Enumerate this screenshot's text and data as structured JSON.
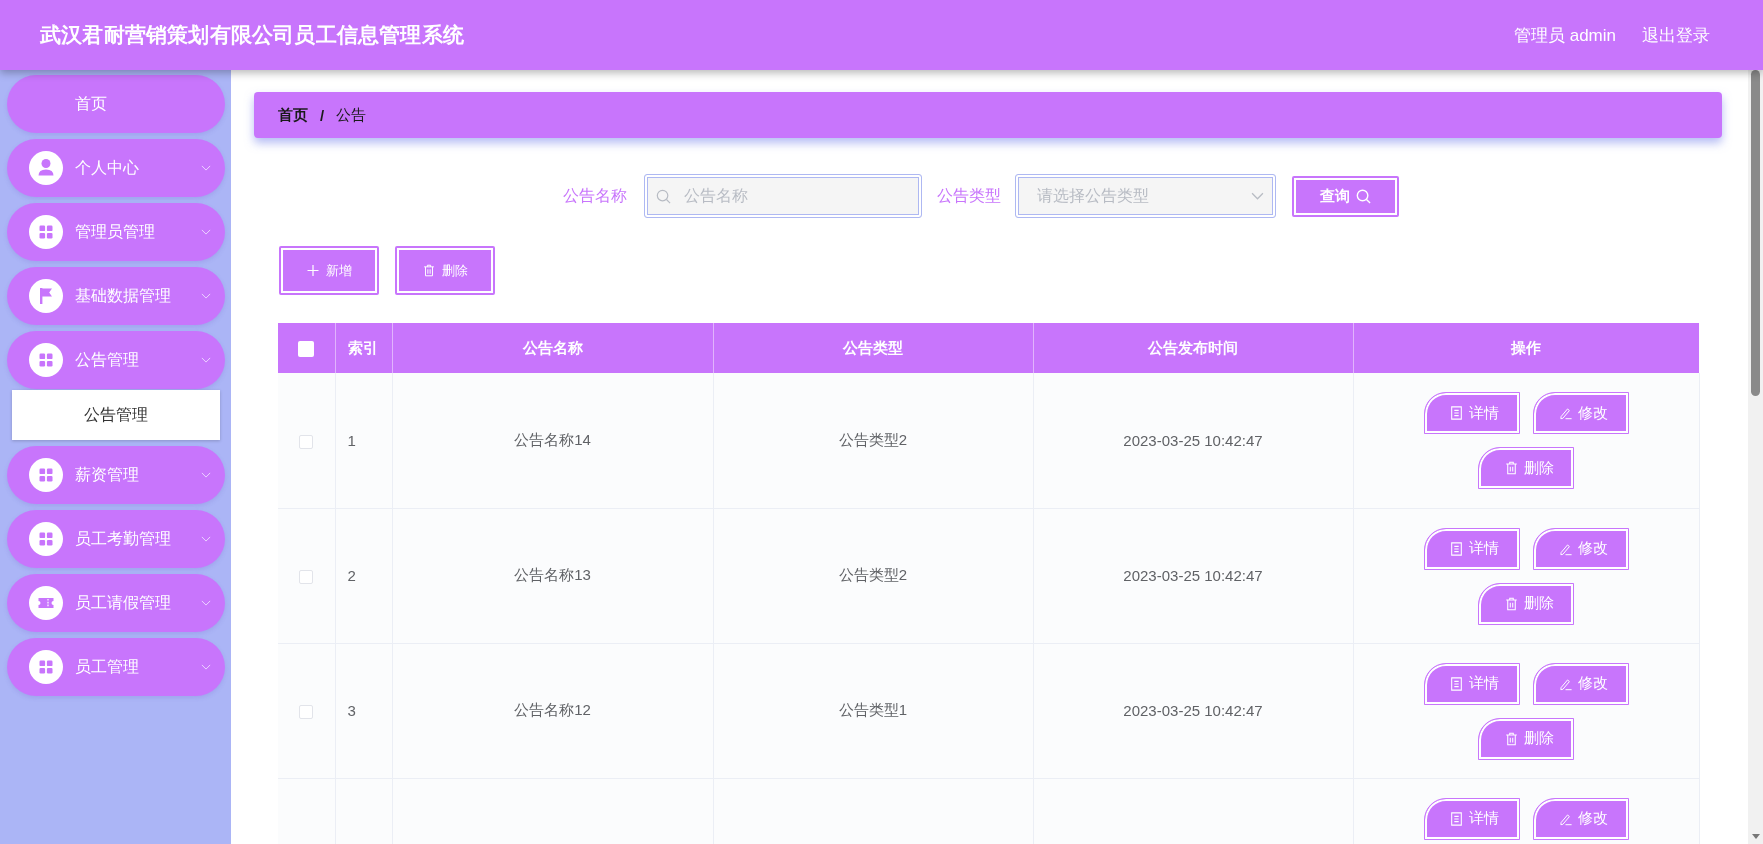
{
  "header": {
    "title": "武汉君耐营销策划有限公司员工信息管理系统",
    "user": "管理员 admin",
    "logout": "退出登录"
  },
  "sidebar": {
    "items": [
      {
        "label": "首页",
        "kind": "link"
      },
      {
        "label": "个人中心",
        "kind": "user"
      },
      {
        "label": "管理员管理",
        "kind": "grid"
      },
      {
        "label": "基础数据管理",
        "kind": "flag"
      },
      {
        "label": "公告管理",
        "kind": "grid",
        "children": [
          {
            "label": "公告管理",
            "selected": true
          }
        ]
      },
      {
        "label": "薪资管理",
        "kind": "grid"
      },
      {
        "label": "员工考勤管理",
        "kind": "grid"
      },
      {
        "label": "员工请假管理",
        "kind": "ticket"
      },
      {
        "label": "员工管理",
        "kind": "grid"
      }
    ]
  },
  "breadcrumb": {
    "separator": "/",
    "items": [
      {
        "label": "首页",
        "kind": "link"
      },
      {
        "label": "公告",
        "kind": "current"
      }
    ]
  },
  "search": {
    "fields": [
      {
        "label": "公告名称",
        "kind": "input",
        "placeholder": "公告名称"
      },
      {
        "label": "公告类型",
        "kind": "select",
        "placeholder": "请选择公告类型"
      }
    ],
    "button": "查询"
  },
  "toolbar": {
    "buttons": [
      {
        "label": "新增",
        "kind": "add"
      },
      {
        "label": "删除",
        "kind": "delete"
      }
    ]
  },
  "table": {
    "columns": [
      "索引",
      "公告名称",
      "公告类型",
      "公告发布时间",
      "操作"
    ],
    "all_checked": false,
    "rows": [
      {
        "checked": false,
        "cells": [
          "1",
          "公告名称14",
          "公告类型2",
          "2023-03-25 10:42:47"
        ],
        "actions": [
          {
            "label": "详情",
            "kind": "detail"
          },
          {
            "label": "修改",
            "kind": "edit"
          },
          {
            "label": "删除",
            "kind": "delete"
          }
        ]
      },
      {
        "checked": false,
        "cells": [
          "2",
          "公告名称13",
          "公告类型2",
          "2023-03-25 10:42:47"
        ],
        "actions": [
          {
            "label": "详情",
            "kind": "detail"
          },
          {
            "label": "修改",
            "kind": "edit"
          },
          {
            "label": "删除",
            "kind": "delete"
          }
        ]
      },
      {
        "checked": false,
        "cells": [
          "3",
          "公告名称12",
          "公告类型1",
          "2023-03-25 10:42:47"
        ],
        "actions": [
          {
            "label": "详情",
            "kind": "detail"
          },
          {
            "label": "修改",
            "kind": "edit"
          },
          {
            "label": "删除",
            "kind": "delete"
          }
        ]
      },
      {
        "actions": [
          {
            "label": "详情",
            "kind": "detail"
          },
          {
            "label": "修改",
            "kind": "edit"
          }
        ]
      }
    ]
  }
}
